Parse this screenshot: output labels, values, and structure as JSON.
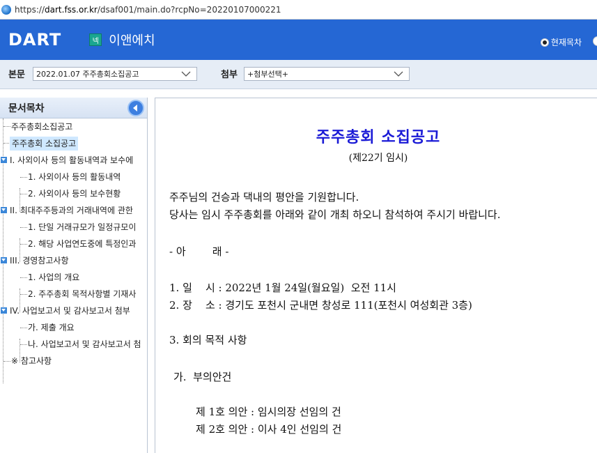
{
  "browser": {
    "url_prefix": "https://",
    "url_host": "dart.fss.or.kr",
    "url_path": "/dsaf001/main.do?rcpNo=20220107000221"
  },
  "header": {
    "logo": "DART",
    "company_badge": "넥",
    "company_name": "이앤에치",
    "toc_option": "현재목차"
  },
  "selectors": {
    "main_label": "본문",
    "main_value": "2022.01.07  주주총회소집공고",
    "attach_label": "첨부",
    "attach_value": "+첨부선택+"
  },
  "sidebar": {
    "title": "문서목차",
    "items": [
      {
        "label": "주주총회소집공고"
      },
      {
        "label": "주주총회 소집공고"
      },
      {
        "label": "I. 사외이사 등의 활동내역과 보수에"
      },
      {
        "label": "1. 사외이사 등의 활동내역"
      },
      {
        "label": "2. 사외이사 등의 보수현황"
      },
      {
        "label": "II. 최대주주등과의 거래내역에 관한"
      },
      {
        "label": "1. 단일 거래규모가 일정규모이"
      },
      {
        "label": "2. 해당 사업연도중에 특정인과"
      },
      {
        "label": "III. 경영참고사항"
      },
      {
        "label": "1. 사업의 개요"
      },
      {
        "label": "2. 주주총회 목적사항별 기재사"
      },
      {
        "label": "IV. 사업보고서 및 감사보고서 첨부"
      },
      {
        "label": "가. 제출 개요"
      },
      {
        "label": "나. 사업보고서 및 감사보고서 첨"
      },
      {
        "label": "※ 참고사항"
      }
    ]
  },
  "document": {
    "title": "주주총회 소집공고",
    "subtitle": "(제22기 임시)",
    "greeting1": "주주님의 건승과 댁내의 평안을 기원합니다.",
    "greeting2": "당사는 임시 주주총회를 아래와 같이 개최 하오니 참석하여 주시기 바랍니다.",
    "below": "- 아        래 -",
    "item1": "1. 일    시 : 2022년 1월 24일(월요일)  오전 11시",
    "item2": "2. 장    소 : 경기도 포천시 군내면 창성로 111(포천시 여성회관 3층)",
    "item3": "3. 회의 목적 사항",
    "sub_ga": "가.  부의안건",
    "agenda1": "제 1호 의안 : 임시의장 선임의 건",
    "agenda2": "제 2호 의안 : 이사 4인 선임의 건"
  }
}
